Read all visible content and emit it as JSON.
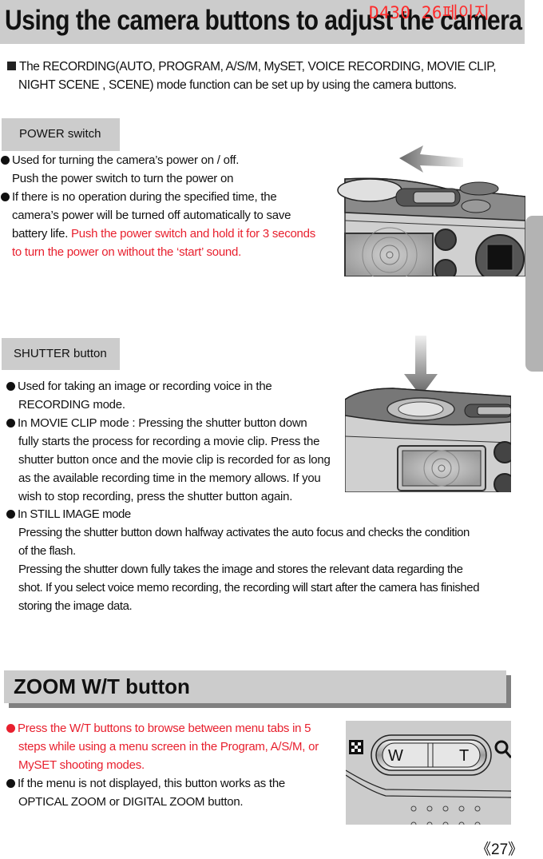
{
  "page": {
    "title": "Using the camera buttons to adjust the camera",
    "stamp": "D430 26페이지",
    "page_number": "27",
    "page_number_prefix": "《",
    "page_number_suffix": "》"
  },
  "intro": {
    "line1": "The RECORDING(AUTO, PROGRAM, A/S/M, MySET, VOICE RECORDING, MOVIE CLIP,",
    "line2": "NIGHT SCENE , SCENE) mode function can be set up by using the camera buttons."
  },
  "power_section": {
    "tag": "POWER switch",
    "bullets": [
      {
        "lines": [
          "Used for turning the camera’s power on / off.",
          "Push the power switch to turn the power on"
        ]
      },
      {
        "lines": [
          "If there is no operation during the specified time, the",
          "camera’s power will be turned off automatically to save"
        ],
        "line3_black": "battery life. ",
        "line3_red": "Push the power switch and hold it for 3 seconds",
        "line4_red": "to turn the power on without the ‘start’ sound."
      }
    ],
    "illustration": "camera-top-power-switch-with-left-arrow"
  },
  "shutter_section": {
    "tag": "SHUTTER button",
    "bullets": [
      {
        "lines": [
          "Used for taking an image or recording voice in the",
          "RECORDING mode."
        ]
      },
      {
        "lines": [
          "In MOVIE CLIP mode : Pressing the shutter button down",
          "fully starts the process for recording a movie clip. Press the",
          "shutter button once and the movie clip is recorded for as long",
          "as the available recording time in the memory allows. If you",
          "wish to stop recording, press the shutter button again."
        ]
      },
      {
        "lines": [
          "In STILL IMAGE mode",
          "Pressing the shutter button down halfway activates the auto focus and checks the condition",
          "of the flash.",
          "Pressing the shutter down fully takes the image and stores the relevant data regarding the",
          "shot. If you select voice memo recording, the recording will start after the camera has finished",
          "storing the image data."
        ]
      }
    ],
    "illustration": "camera-top-shutter-button-with-down-arrow"
  },
  "zoom_section": {
    "heading": "ZOOM W/T button",
    "bullets": [
      {
        "red": true,
        "lines": [
          "Press the W/T buttons to browse between menu tabs in 5",
          "steps while using a menu screen in the Program, A/S/M, or",
          "MySET shooting modes."
        ]
      },
      {
        "red": false,
        "lines": [
          "If the menu is not displayed, this button works as the",
          "OPTICAL ZOOM or DIGITAL ZOOM button."
        ]
      }
    ],
    "illustration": {
      "w_label": "W",
      "t_label": "T"
    }
  },
  "colors": {
    "accent_red": "#e8202e",
    "bar_gray": "#cccccc",
    "shadow_gray": "#808080",
    "side_tab_gray": "#b3b3b3"
  }
}
